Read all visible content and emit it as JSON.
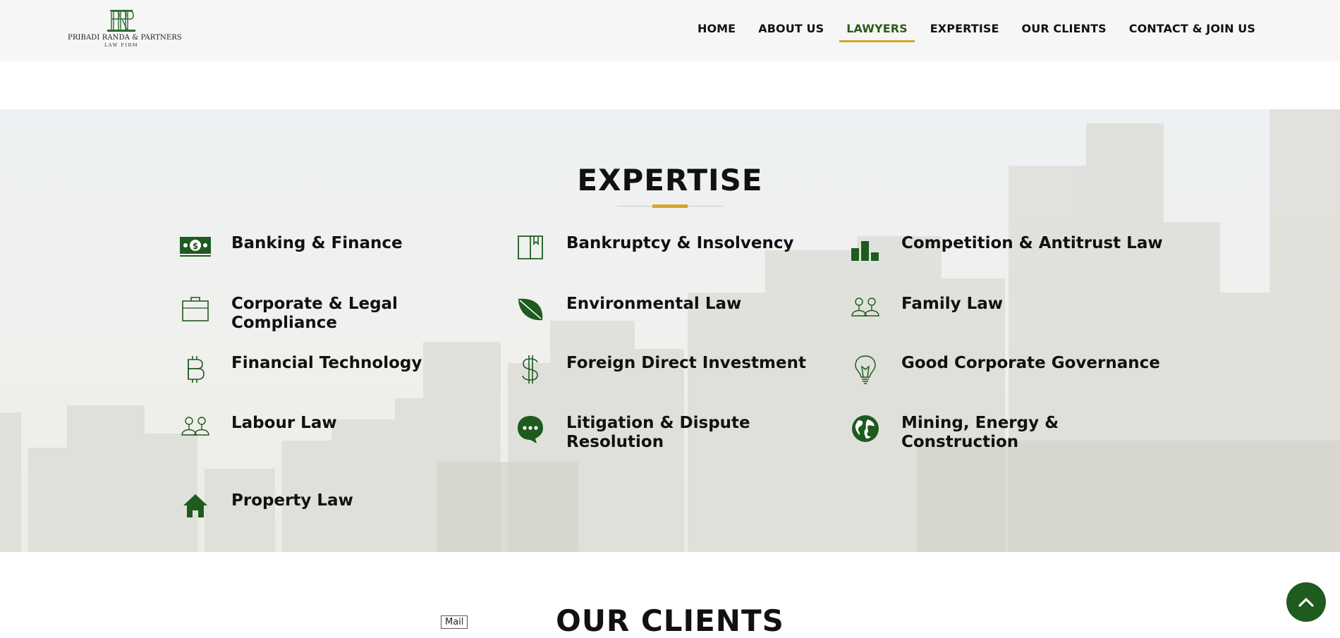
{
  "logo": {
    "name": "PRIBADI RANDA & PARTNERS",
    "subtitle": "LAW FIRM"
  },
  "nav": [
    {
      "label": "HOME",
      "active": false
    },
    {
      "label": "ABOUT US",
      "active": false
    },
    {
      "label": "LAWYERS",
      "active": true
    },
    {
      "label": "EXPERTISE",
      "active": false
    },
    {
      "label": "OUR CLIENTS",
      "active": false
    },
    {
      "label": "CONTACT & JOIN US",
      "active": false
    }
  ],
  "expertise": {
    "title": "EXPERTISE",
    "items": [
      {
        "label": "Banking & Finance",
        "icon": "banknote-icon"
      },
      {
        "label": "Bankruptcy & Insolvency",
        "icon": "book-icon"
      },
      {
        "label": "Competition & Antitrust Law",
        "icon": "bar-chart-icon"
      },
      {
        "label": "Corporate & Legal Compliance",
        "icon": "briefcase-icon"
      },
      {
        "label": "Environmental Law",
        "icon": "leaf-icon"
      },
      {
        "label": "Family Law",
        "icon": "people-icon"
      },
      {
        "label": "Financial Technology",
        "icon": "bitcoin-icon"
      },
      {
        "label": "Foreign Direct Investment",
        "icon": "dollar-icon"
      },
      {
        "label": "Good Corporate Governance",
        "icon": "lightbulb-icon"
      },
      {
        "label": "Labour Law",
        "icon": "people-icon"
      },
      {
        "label": "Litigation & Dispute Resolution",
        "icon": "chat-bubble-icon"
      },
      {
        "label": "Mining, Energy & Construction",
        "icon": "globe-icon"
      },
      {
        "label": "Property Law",
        "icon": "house-icon"
      }
    ]
  },
  "clients": {
    "title": "OUR CLIENTS"
  },
  "mail_tag": "Mail",
  "colors": {
    "brand_green": "#1e5b1e",
    "accent_gold": "#d4a62a",
    "header_bg": "#f6f6f6"
  }
}
